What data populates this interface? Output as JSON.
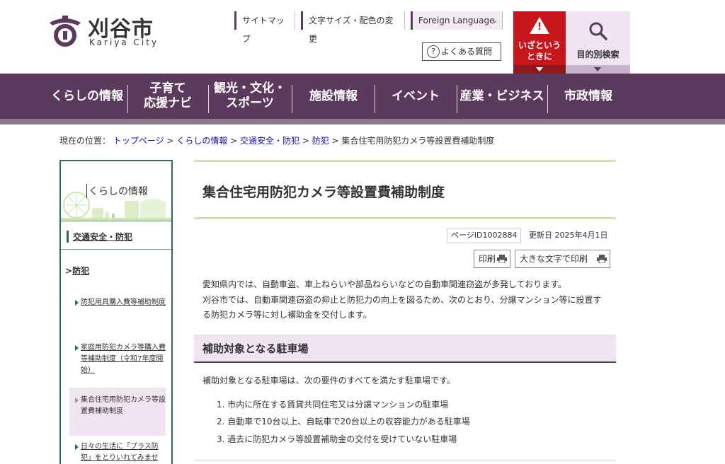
{
  "header": {
    "logo_title": "刈谷市",
    "logo_sub": "Kariya City",
    "sitemap": "サイトマップ",
    "text_size": "文字サイズ・配色の変更",
    "foreign": "Foreign Language",
    "faq": "よくある質問",
    "emergency_line1": "いざという",
    "emergency_line2": "ときに",
    "purpose_search": "目的別検索"
  },
  "gnav": [
    {
      "line1": "くらしの情報",
      "line2": ""
    },
    {
      "line1": "子育て",
      "line2": "応援ナビ"
    },
    {
      "line1": "観光・文化・",
      "line2": "スポーツ"
    },
    {
      "line1": "施設情報",
      "line2": ""
    },
    {
      "line1": "イベント",
      "line2": ""
    },
    {
      "line1": "産業・ビジネス",
      "line2": ""
    },
    {
      "line1": "市政情報",
      "line2": ""
    }
  ],
  "breadcrumb": {
    "prefix": "現在の位置：",
    "items": [
      "トップページ",
      "くらしの情報",
      "交通安全・防犯",
      "防犯"
    ],
    "current": "集合住宅用防犯カメラ等設置費補助制度"
  },
  "sidebar": {
    "title": "くらしの情報",
    "category": "交通安全・防犯",
    "sub": "防犯",
    "items": [
      "防犯用具購入費等補助制度",
      "家庭用防犯カメラ等購入費等補助制度（令和7年度開始）",
      "集合住宅用防犯カメラ等設置費補助制度",
      "日々の生活に「プラス防犯」をとりいれてみませ"
    ]
  },
  "main": {
    "title": "集合住宅用防犯カメラ等設置費補助制度",
    "page_id": "ページID1002884",
    "updated": "更新日 2025年4月1日",
    "print": "印刷",
    "print_large": "大きな文字で印刷",
    "intro1": "愛知県内では、自動車盗、車上ねらいや部品ねらいなどの自動車関連窃盗が多発しております。",
    "intro2": "刈谷市では、自動車関連窃盗の抑止と防犯力の向上を図るため、次のとおり、分譲マンション等に設置する防犯カメラ等に対し補助金を交付します。",
    "section_title": "補助対象となる駐車場",
    "section_lead": "補助対象となる駐車場は、次の要件のすべてを満たす駐車場です。",
    "requirements": [
      "1. 市内に所在する賃貸共同住宅又は分譲マンションの駐車場",
      "2. 自動車で10台以上、自転車で20台以上の収容能力がある駐車場",
      "3. 過去に防犯カメラ等設置補助金の交付を受けていない駐車場"
    ]
  },
  "colors": {
    "brand": "#5c3a5e",
    "emergency": "#c8161d",
    "accent_green": "#2e6b5a",
    "title_line": "#cfe4b2",
    "section_bg": "#efe4f0"
  }
}
